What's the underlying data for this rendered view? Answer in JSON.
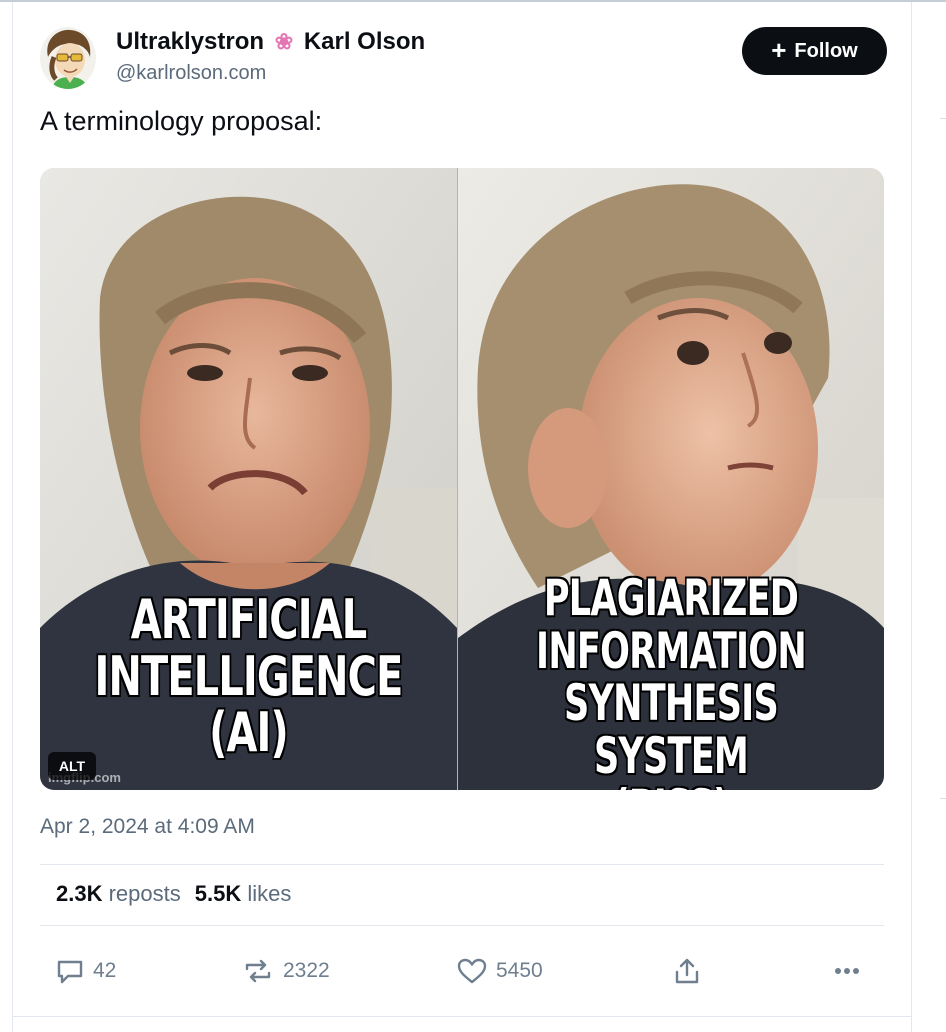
{
  "post": {
    "author_name_left": "Ultraklystron",
    "author_name_right": "Karl Olson",
    "author_flower_glyph": "❀",
    "author_handle": "@karlrolson.com",
    "follow_label": "Follow",
    "follow_plus": "+",
    "text": "A terminology proposal:",
    "media": {
      "left_caption": [
        "ARTIFICIAL",
        "INTELLIGENCE",
        "(AI)"
      ],
      "right_caption": [
        "PLAGIARIZED",
        "INFORMATION",
        "SYNTHESIS SYSTEM",
        "(PISS)"
      ],
      "alt_label": "ALT",
      "watermark": "imgflip.com"
    },
    "timestamp": "Apr 2, 2024 at 4:09 AM",
    "stats": {
      "reposts_count": "2.3K",
      "reposts_label": "reposts",
      "likes_count": "5.5K",
      "likes_label": "likes"
    },
    "actions": {
      "reply_count": "42",
      "repost_count": "2322",
      "like_count": "5450"
    }
  },
  "icons": {
    "avatar": "avatar-icon",
    "reply": "comment-icon",
    "repost": "repost-icon",
    "like": "heart-icon",
    "share": "share-icon",
    "more": "more-dots-icon"
  },
  "colors": {
    "text_primary": "#0b0f14",
    "text_secondary": "#5b6b7b",
    "action_gray": "#6f7f8f",
    "follow_bg": "#0b0f14",
    "divider": "#e3e8ee",
    "flower_pink": "#e277b4"
  }
}
